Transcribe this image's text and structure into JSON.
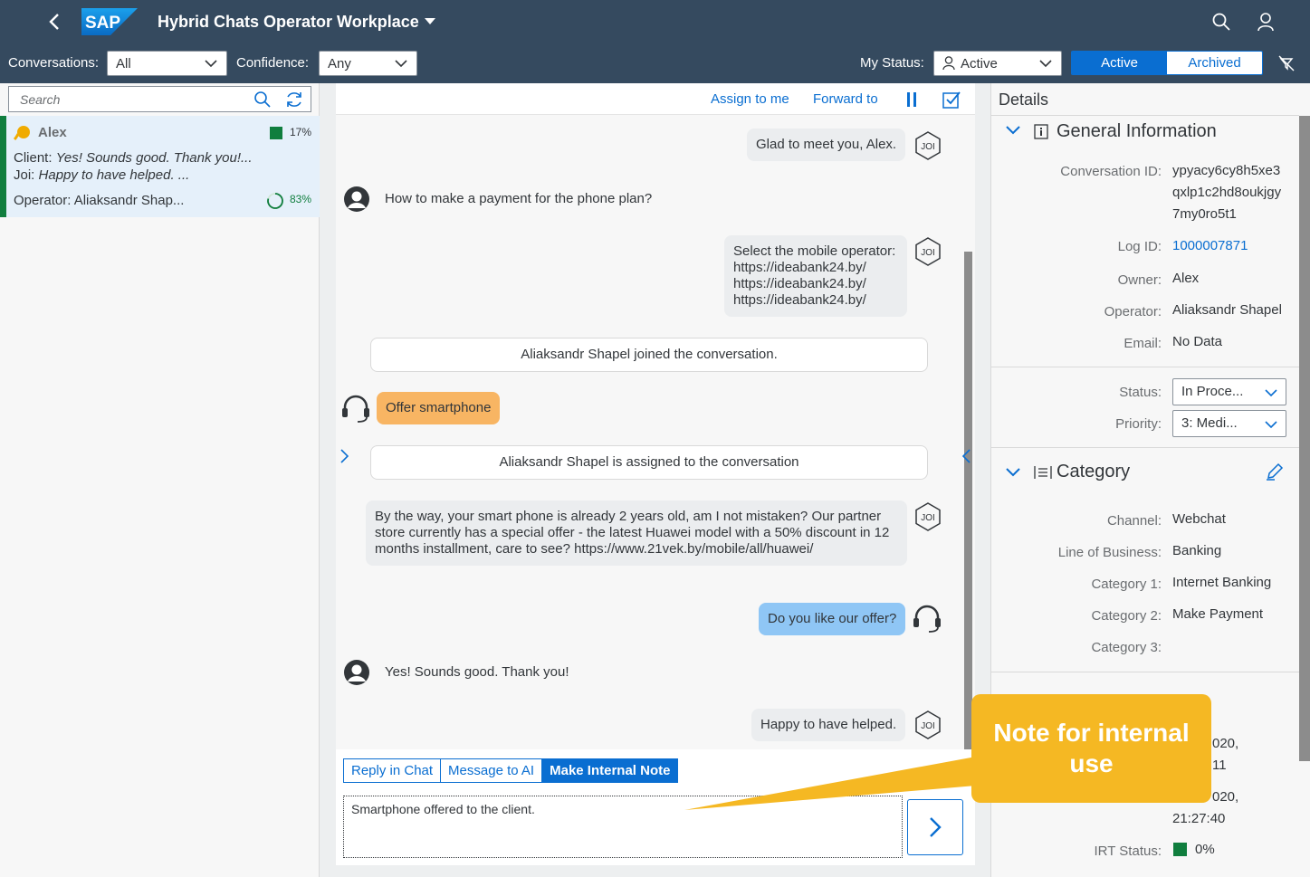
{
  "shell": {
    "title": "Hybrid Chats Operator Workplace",
    "logo_text": "SAP"
  },
  "toolbar": {
    "conversations_label": "Conversations:",
    "conversations_value": "All",
    "confidence_label": "Confidence:",
    "confidence_value": "Any",
    "my_status_label": "My Status:",
    "my_status_value": "Active",
    "seg_active": "Active",
    "seg_archived": "Archived"
  },
  "left": {
    "search_placeholder": "Search",
    "conversation": {
      "name": "Alex",
      "confidence_pct": "17%",
      "client_label": "Client:",
      "client_text": "Yes! Sounds good. Thank you!...",
      "joi_label": "Joi:",
      "joi_text": "Happy to have helped. ...",
      "operator_text": "Operator: Aliaksandr Shap...",
      "progress_pct": "83%"
    }
  },
  "center": {
    "assign_to_me": "Assign to me",
    "forward_to": "Forward to",
    "bot_badge": "JOI",
    "messages": {
      "m1": "Glad to meet you, Alex.",
      "m2": "How to make a payment for the phone plan?",
      "m3_l1": "Select the mobile operator:",
      "m3_l2": "https://ideabank24.by/",
      "m3_l3": "https://ideabank24.by/",
      "m3_l4": "https://ideabank24.by/",
      "m4": "Aliaksandr Shapel joined the conversation.",
      "m5": "Offer smartphone",
      "m6": "Aliaksandr Shapel is assigned to the conversation",
      "m7": "By the way, your smart phone is already 2 years old, am I not mistaken? Our partner store currently has a special offer - the latest Huawei model with a 50% discount in 12 months installment, care to see? https://www.21vek.by/mobile/all/huawei/",
      "m8": "Do you like our offer?",
      "m9": "Yes! Sounds good. Thank you!",
      "m10": "Happy to have helped."
    },
    "tabs": {
      "reply": "Reply in Chat",
      "message_ai": "Message to AI",
      "internal_note": "Make Internal Note"
    },
    "composer_text": "Smartphone offered to the client."
  },
  "details": {
    "header": "Details",
    "general_title": "General Information",
    "conversation_id_label": "Conversation ID:",
    "conversation_id_l1": "ypyacy6cy8h5xe3",
    "conversation_id_l2": "qxlp1c2hd8oukjgy",
    "conversation_id_l3": "7my0ro5t1",
    "log_id_label": "Log ID:",
    "log_id_value": "1000007871",
    "owner_label": "Owner:",
    "owner_value": "Alex",
    "operator_label": "Operator:",
    "operator_value": "Aliaksandr Shapel",
    "email_label": "Email:",
    "email_value": "No Data",
    "status_label": "Status:",
    "status_value": "In Proce...",
    "priority_label": "Priority:",
    "priority_value": "3: Medi...",
    "category_title": "Category",
    "channel_label": "Channel:",
    "channel_value": "Webchat",
    "lob_label": "Line of Business:",
    "lob_value": "Banking",
    "cat1_label": "Category 1:",
    "cat1_value": "Internet Banking",
    "cat2_label": "Category 2:",
    "cat2_value": "Make Payment",
    "cat3_label": "Category 3:",
    "cat3_value": "",
    "partial_1": "020,",
    "partial_2": "11",
    "partial_3": "020,",
    "partial_4": "21:27:40",
    "irt_label": "IRT Status:",
    "irt_value": "0%"
  },
  "callout": {
    "text": "Note for internal use"
  },
  "colors": {
    "shell": "#354a5f",
    "accent": "#0a6ed1",
    "positive": "#107e3e",
    "callout": "#f5b823",
    "operator_bubble": "#f8b563",
    "client_bubble": "#8fc6f5"
  }
}
